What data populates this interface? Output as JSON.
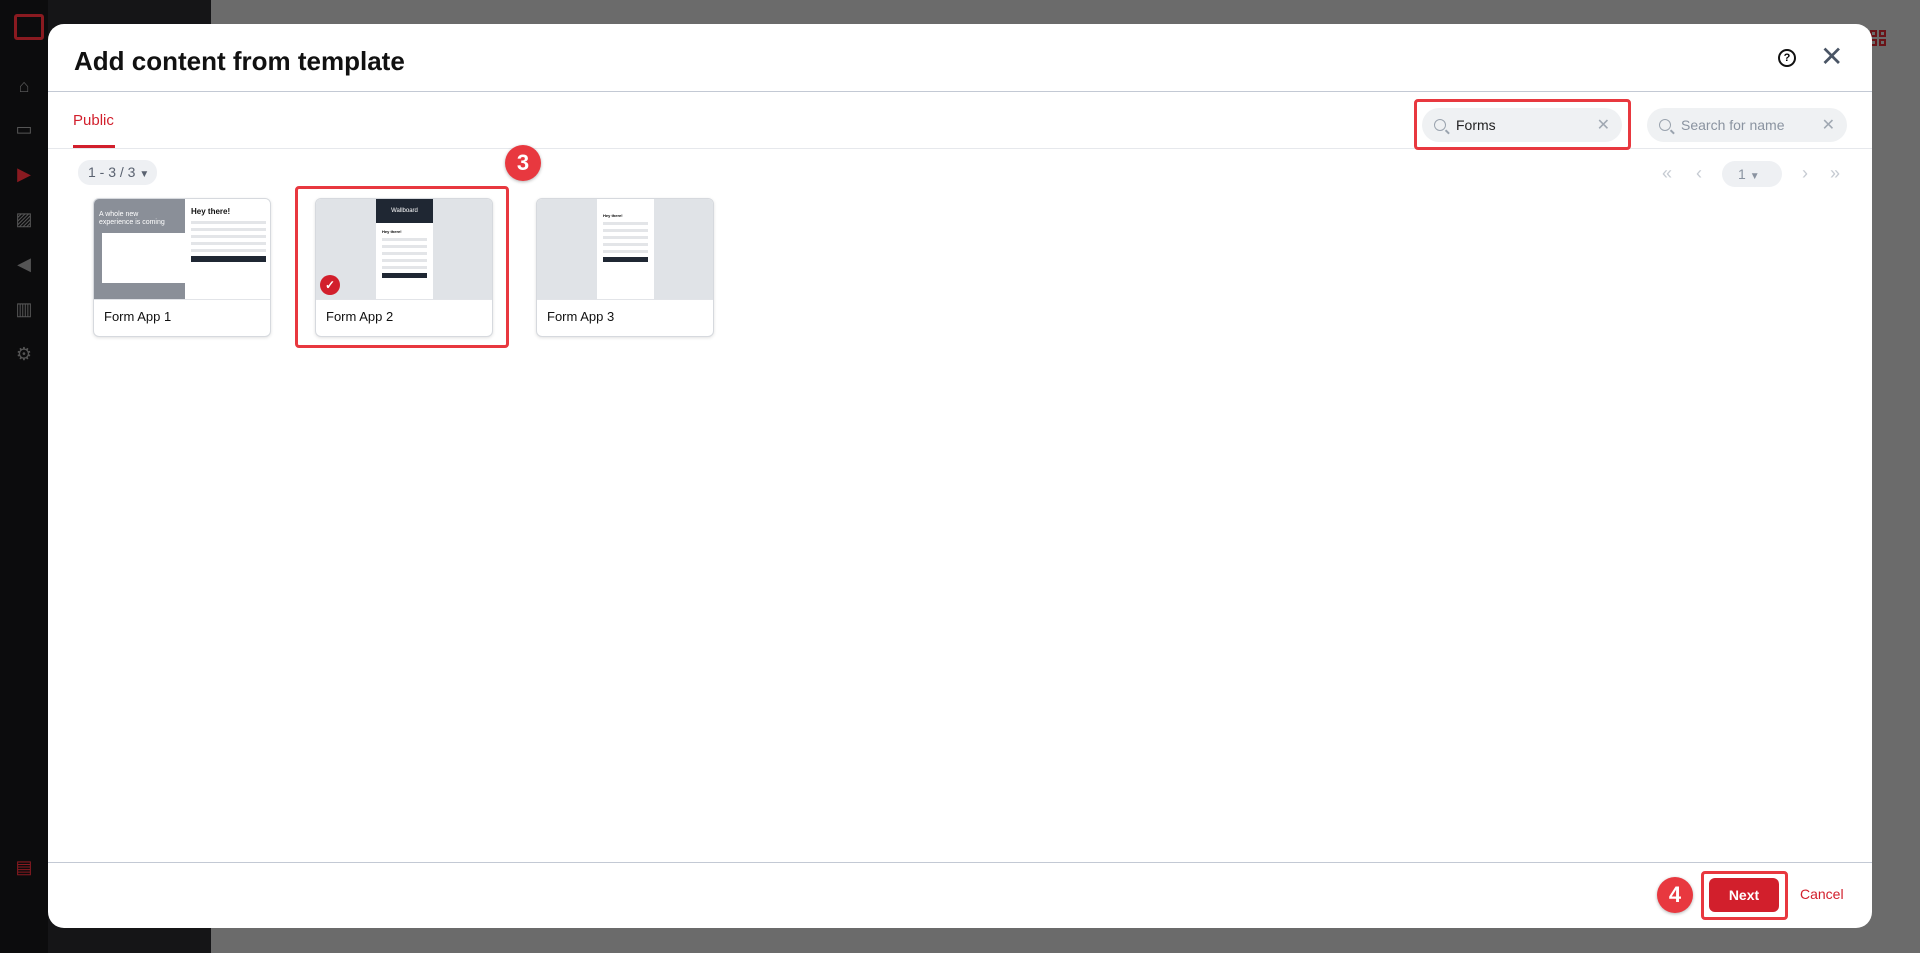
{
  "modal": {
    "title": "Add content from template",
    "tabs": [
      {
        "label": "Public",
        "active": true
      }
    ],
    "filter_search": {
      "value": "Forms",
      "placeholder": ""
    },
    "name_search": {
      "value": "",
      "placeholder": "Search for name"
    },
    "result_count": "1 - 3 / 3",
    "pagination": {
      "current_page": "1"
    },
    "templates": [
      {
        "name": "Form App 1",
        "selected": false,
        "thumb_heading": "A whole new experience is coming",
        "thumb_form_title": "Hey there!"
      },
      {
        "name": "Form App 2",
        "selected": true,
        "thumb_brand": "Wallboard",
        "thumb_form_title": "Hey there!"
      },
      {
        "name": "Form App 3",
        "selected": false,
        "thumb_form_title": "Hey there!"
      }
    ],
    "footer": {
      "next_label": "Next",
      "cancel_label": "Cancel"
    }
  },
  "annotations": {
    "step_3": "3",
    "step_4": "4",
    "highlight_color": "#e8383f"
  },
  "colors": {
    "accent": "#d21f2c"
  }
}
